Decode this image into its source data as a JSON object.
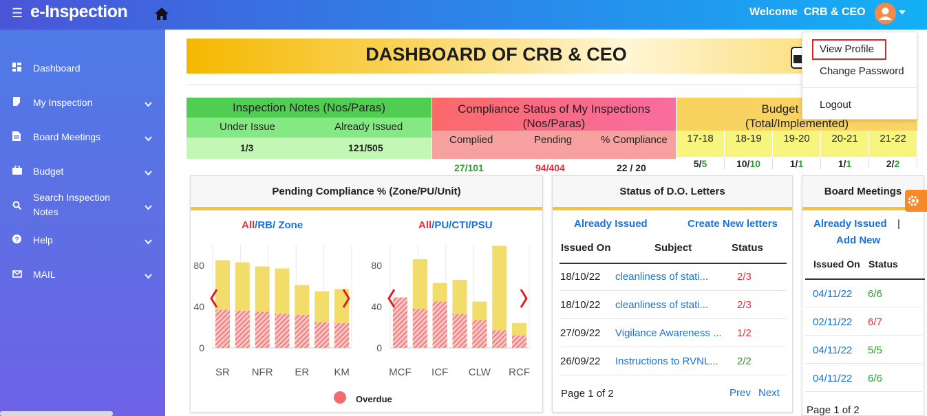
{
  "header": {
    "brand": "e-Inspection",
    "welcome": "Welcome",
    "user": "CRB & CEO"
  },
  "user_menu": {
    "items": [
      "View Profile",
      "Change Password",
      "Logout"
    ]
  },
  "sidebar": {
    "items": [
      {
        "label": "Dashboard",
        "icon": "dashboard-icon"
      },
      {
        "label": "My Inspection",
        "icon": "bookmark-icon"
      },
      {
        "label": "Board Meetings",
        "icon": "document-icon"
      },
      {
        "label": "Budget",
        "icon": "briefcase-icon"
      },
      {
        "label": "Search Inspection",
        "label2": "Notes",
        "icon": "search-icon"
      },
      {
        "label": "Help",
        "icon": "help-icon"
      },
      {
        "label": "MAIL",
        "icon": "mail-icon"
      }
    ]
  },
  "page_title": "DASHBOARD OF CRB & CEO",
  "inspection_notes": {
    "title": "Inspection Notes (Nos/Paras)",
    "col1": "Under Issue",
    "col2": "Already Issued",
    "val1": "1/3",
    "val2": "121/505"
  },
  "compliance": {
    "title1": "Compliance Status of My Inspections",
    "title2": "(Nos/Paras)",
    "col1": "Complied",
    "col2": "Pending",
    "col3": "% Compliance",
    "val1": "27/101",
    "val2": "94/404",
    "val3": "22 / 20"
  },
  "budget": {
    "title1": "Budget Pronc",
    "title2": "(Total/Implemented)",
    "years": [
      "17-18",
      "18-19",
      "19-20",
      "20-21",
      "21-22"
    ],
    "values": [
      {
        "a": "5/",
        "b": "5"
      },
      {
        "a": "10/",
        "b": "10"
      },
      {
        "a": "1/",
        "b": "1"
      },
      {
        "a": "1/",
        "b": "1"
      },
      {
        "a": "2/",
        "b": "2"
      }
    ]
  },
  "pending_card": {
    "title": "Pending Compliance % (Zone/PU/Unit)",
    "left_filter": {
      "a": "All",
      "b": "/RB/",
      "c": " Zone"
    },
    "right_filter": {
      "a": "All",
      "b": "/PU/",
      "c": "CTI",
      "d": "/PSU"
    },
    "legend": "Overdue"
  },
  "chart_data": [
    {
      "type": "bar",
      "categories": [
        "SR",
        "",
        "NFR",
        "",
        "ER",
        "",
        "KM"
      ],
      "yticks": [
        "0",
        "40",
        "80"
      ],
      "ylim": [
        0,
        100
      ],
      "series": [
        {
          "values": [
            85,
            83,
            79,
            77,
            61,
            55,
            57
          ]
        },
        {
          "name": "Overdue",
          "values": [
            37,
            36,
            35,
            33,
            32,
            25,
            24
          ]
        }
      ],
      "colors": [
        "#f2dc6a",
        "#f26b6b"
      ]
    },
    {
      "type": "bar",
      "categories": [
        "MCF",
        "",
        "ICF",
        "",
        "CLW",
        "",
        "RCF"
      ],
      "yticks": [
        "0",
        "40",
        "80"
      ],
      "ylim": [
        0,
        100
      ],
      "series": [
        {
          "values": [
            49,
            86,
            63,
            66,
            45,
            99,
            24
          ]
        },
        {
          "name": "Overdue",
          "values": [
            49,
            38,
            45,
            33,
            27,
            17,
            12
          ]
        }
      ],
      "colors": [
        "#f2dc6a",
        "#f26b6b"
      ]
    }
  ],
  "do_letters": {
    "title": "Status of D.O. Letters",
    "link1": "Already Issued",
    "link2": "Create New letters",
    "headers": [
      "Issued On",
      "Subject",
      "Status"
    ],
    "rows": [
      {
        "date": "18/10/22",
        "subject": "cleanliness of stati...",
        "status": "2/3"
      },
      {
        "date": "18/10/22",
        "subject": "cleanliness of stati...",
        "status": "2/3"
      },
      {
        "date": "27/09/22",
        "subject": "Vigilance Awareness ...",
        "status": "1/2"
      },
      {
        "date": "26/09/22",
        "subject": "Instructions to RVNL...",
        "status": "2/2"
      }
    ],
    "page": "Page 1 of 2",
    "prev": "Prev",
    "next": "Next"
  },
  "board_meetings": {
    "title": "Board Meetings",
    "link1": "Already Issued",
    "sep": "|",
    "link2": "Add New",
    "headers": [
      "Issued On",
      "Status"
    ],
    "rows": [
      {
        "date": "04/11/22",
        "status": "6/6"
      },
      {
        "date": "02/11/22",
        "status": "6/7"
      },
      {
        "date": "04/11/22",
        "status": "5/5"
      },
      {
        "date": "04/11/22",
        "status": "6/6"
      }
    ],
    "page": "Page 1 of 2"
  }
}
